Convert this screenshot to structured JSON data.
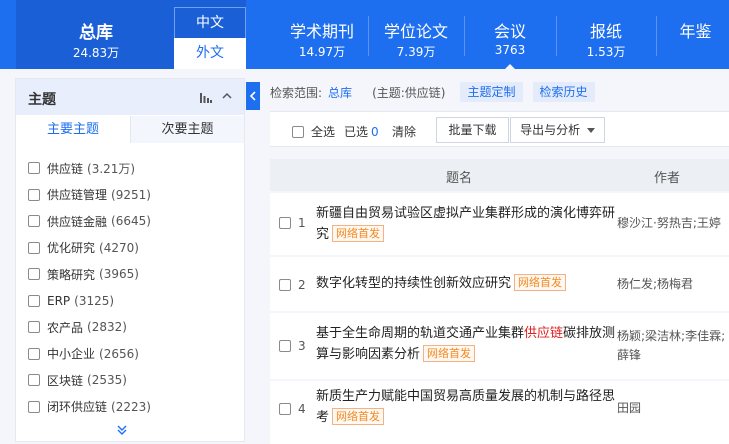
{
  "db_tabs": {
    "total": {
      "label": "总库",
      "count": "24.83万"
    },
    "lang_cn": "中文",
    "lang_en": "外文",
    "tabs": [
      {
        "label": "学术期刊",
        "count": "14.97万"
      },
      {
        "label": "学位论文",
        "count": "7.39万"
      },
      {
        "label": "会议",
        "count": "3763"
      },
      {
        "label": "报纸",
        "count": "1.53万"
      },
      {
        "label": "年鉴",
        "count": ""
      }
    ]
  },
  "sidebar": {
    "title": "主题",
    "tab_primary": "主要主题",
    "tab_secondary": "次要主题",
    "topics": [
      {
        "label": "供应链",
        "count": "(3.21万)"
      },
      {
        "label": "供应链管理",
        "count": "(9251)"
      },
      {
        "label": "供应链金融",
        "count": "(6645)"
      },
      {
        "label": "优化研究",
        "count": "(4270)"
      },
      {
        "label": "策略研究",
        "count": "(3965)"
      },
      {
        "label": "ERP",
        "count": "(3125)"
      },
      {
        "label": "农产品",
        "count": "(2832)"
      },
      {
        "label": "中小企业",
        "count": "(2656)"
      },
      {
        "label": "区块链",
        "count": "(2535)"
      },
      {
        "label": "闭环供应链",
        "count": "(2223)"
      }
    ],
    "more_icon": "double-chevron-down-icon"
  },
  "search": {
    "range_label": "检索范围:",
    "range_db": "总库",
    "range_theme": "(主题:供应链)",
    "custom_theme": "主题定制",
    "history": "检索历史"
  },
  "toolbar": {
    "select_all": "全选",
    "selected_label": "已选",
    "selected_count": "0",
    "clear": "清除",
    "batch_download": "批量下载",
    "export": "导出与分析"
  },
  "table": {
    "col_title": "题名",
    "col_author": "作者",
    "badge": "网络首发",
    "rows": [
      {
        "num": "1",
        "title_a": "新疆自由贸易试验区虚拟产业集群形成的演化博弈研究",
        "title_hl": "",
        "title_b": "",
        "author": "穆沙江·努热吉;王婷"
      },
      {
        "num": "2",
        "title_a": "数字化转型的持续性创新效应研究",
        "title_hl": "",
        "title_b": "",
        "author": "杨仁发;杨梅君"
      },
      {
        "num": "3",
        "title_a": "基于全生命周期的轨道交通产业集群",
        "title_hl": "供应链",
        "title_b": "碳排放测算与影响因素分析",
        "author": "杨颖;梁洁林;李佳霖;薛锋"
      },
      {
        "num": "4",
        "title_a": "新质生产力赋能中国贸易高质量发展的机制与路径思考",
        "title_hl": "",
        "title_b": "",
        "author": "田园"
      }
    ]
  },
  "colors": {
    "brand_blue": "#1e6ff0",
    "highlight_red": "#e02020",
    "badge_orange": "#f08a24"
  }
}
